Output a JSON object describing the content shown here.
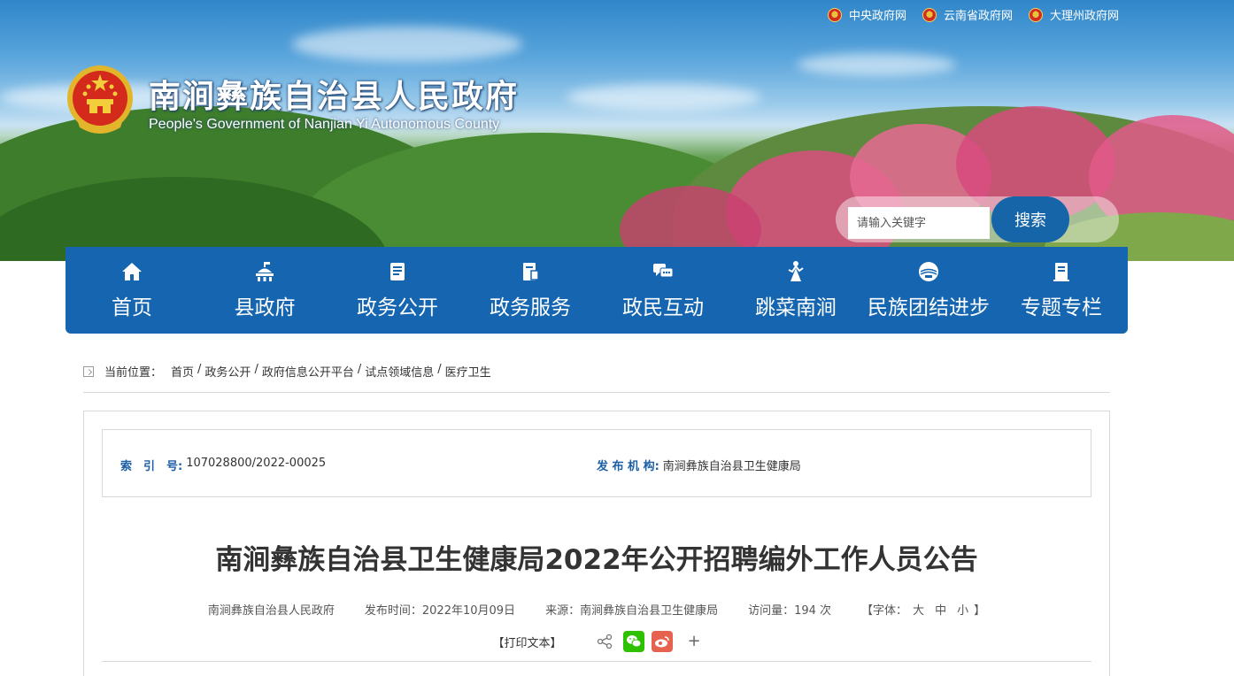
{
  "top_links": [
    {
      "label": "中央政府网"
    },
    {
      "label": "云南省政府网"
    },
    {
      "label": "大理州政府网"
    }
  ],
  "site": {
    "title": "南涧彝族自治县人民政府",
    "subtitle": "People's Government of Nanjian Yi Autonomous County"
  },
  "search": {
    "placeholder": "请输入关键字",
    "button_label": "搜索"
  },
  "nav": [
    {
      "label": "首页",
      "icon": "home-icon"
    },
    {
      "label": "县政府",
      "icon": "government-building-icon"
    },
    {
      "label": "政务公开",
      "icon": "document-icon"
    },
    {
      "label": "政务服务",
      "icon": "service-icon"
    },
    {
      "label": "政民互动",
      "icon": "chat-icon"
    },
    {
      "label": "跳菜南涧",
      "icon": "dancer-icon"
    },
    {
      "label": "民族团结进步",
      "icon": "unity-icon"
    },
    {
      "label": "专题专栏",
      "icon": "topic-icon"
    }
  ],
  "breadcrumb": {
    "label": "当前位置：",
    "items": [
      "首页",
      "政务公开",
      "政府信息公开平台",
      "试点领域信息",
      "医疗卫生"
    ],
    "separator": "/"
  },
  "meta": {
    "index_key": "索　引　号:",
    "index_value": "107028800/2022-00025",
    "org_key": "发 布 机 构:",
    "org_value": "南涧彝族自治县卫生健康局"
  },
  "article": {
    "title": "南涧彝族自治县卫生健康局2022年公开招聘编外工作人员公告",
    "publisher": "南涧彝族自治县人民政府",
    "publish_time": "发布时间：2022年10月09日",
    "source": "来源：南涧彝族自治县卫生健康局",
    "visits": "访问量：194 次",
    "font_label_open": "【字体：",
    "font_large": "大",
    "font_medium": "中",
    "font_small": "小",
    "font_label_close": "】",
    "print_label": "【打印文本】",
    "plus": "+"
  },
  "colors": {
    "nav_bg": "#1565b0",
    "meta_key": "#1d5fa6",
    "wechat": "#2dc100",
    "weibo": "#e6624e"
  }
}
